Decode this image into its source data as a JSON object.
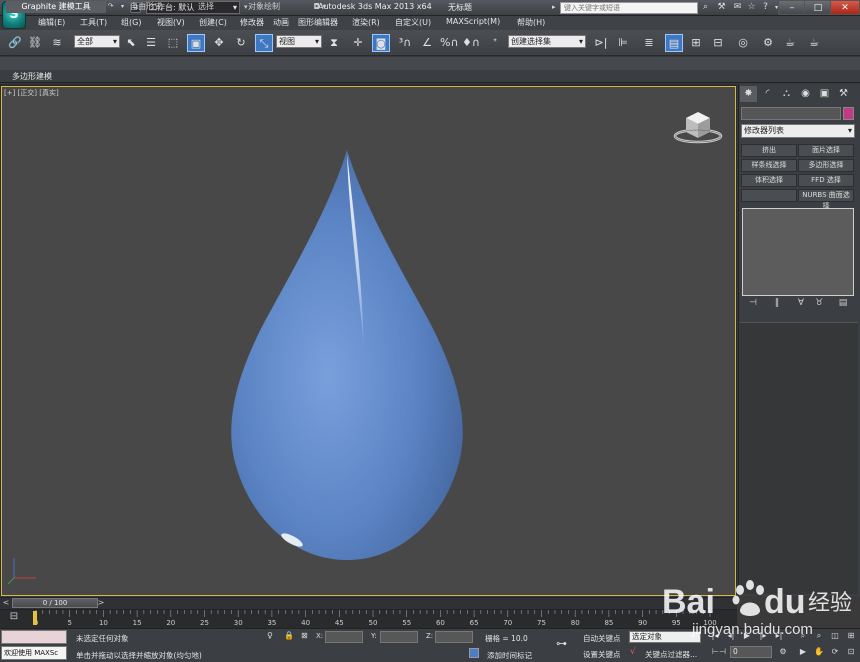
{
  "window": {
    "app_title": "Autodesk 3ds Max  2013 x64",
    "file_title": "无标题",
    "workspace_label": "工作台: 默认",
    "search_placeholder": "键入关键字或短语",
    "logo_glyph": "S"
  },
  "menu": {
    "items": [
      "编辑(E)",
      "工具(T)",
      "组(G)",
      "视图(V)",
      "创建(C)",
      "修改器",
      "动画",
      "图形编辑器",
      "渲染(R)",
      "自定义(U)",
      "MAXScript(M)",
      "帮助(H)"
    ]
  },
  "toolbar": {
    "selection_filter": "全部",
    "ref_coord": "视图",
    "named_selection": "创建选择集"
  },
  "ribbon": {
    "tabs": [
      "Graphite 建模工具",
      "自由形式",
      "选择",
      "对象绘制"
    ],
    "options_glyph": "◘ ▾",
    "sub_label": "多边形建模"
  },
  "viewport": {
    "label": "[+] [正交] [真实]",
    "object": "water-drop",
    "drop_color": "#5b84c4",
    "border_color": "#d4b64a"
  },
  "command_panel": {
    "modifier_list": "修改器列表",
    "buttons": [
      "挤出",
      "面片选择",
      "样条线选择",
      "多边形选择",
      "体积选择",
      "FFD 选择",
      "",
      "NURBS 曲面选择"
    ],
    "swatch_color": "#c03a86"
  },
  "timeline": {
    "slider_label": "0 / 100",
    "tick_labels": [
      "0",
      "5",
      "10",
      "15",
      "20",
      "25",
      "30",
      "35",
      "40",
      "45",
      "50",
      "55",
      "60",
      "65",
      "70",
      "75",
      "80",
      "85",
      "90",
      "95",
      "100"
    ]
  },
  "status": {
    "maxscript_text": "欢迎使用 MAXSc",
    "selection_status": "未选定任何对象",
    "prompt": "单击并拖动以选择并缩放对象(均匀地)",
    "x_label": "X:",
    "y_label": "Y:",
    "z_label": "Z:",
    "grid_label": "栅格 = 10.0",
    "add_time_tag": "添加时间标记",
    "auto_key": "自动关键点",
    "selected_dd": "选定对象",
    "set_key": "设置关键点",
    "key_filters": "关键点过滤器...",
    "frame_value": "0"
  },
  "watermark": {
    "brand_left": "Bai",
    "brand_right": "du",
    "suffix": "经验",
    "url": "jingyan.baidu.com"
  }
}
